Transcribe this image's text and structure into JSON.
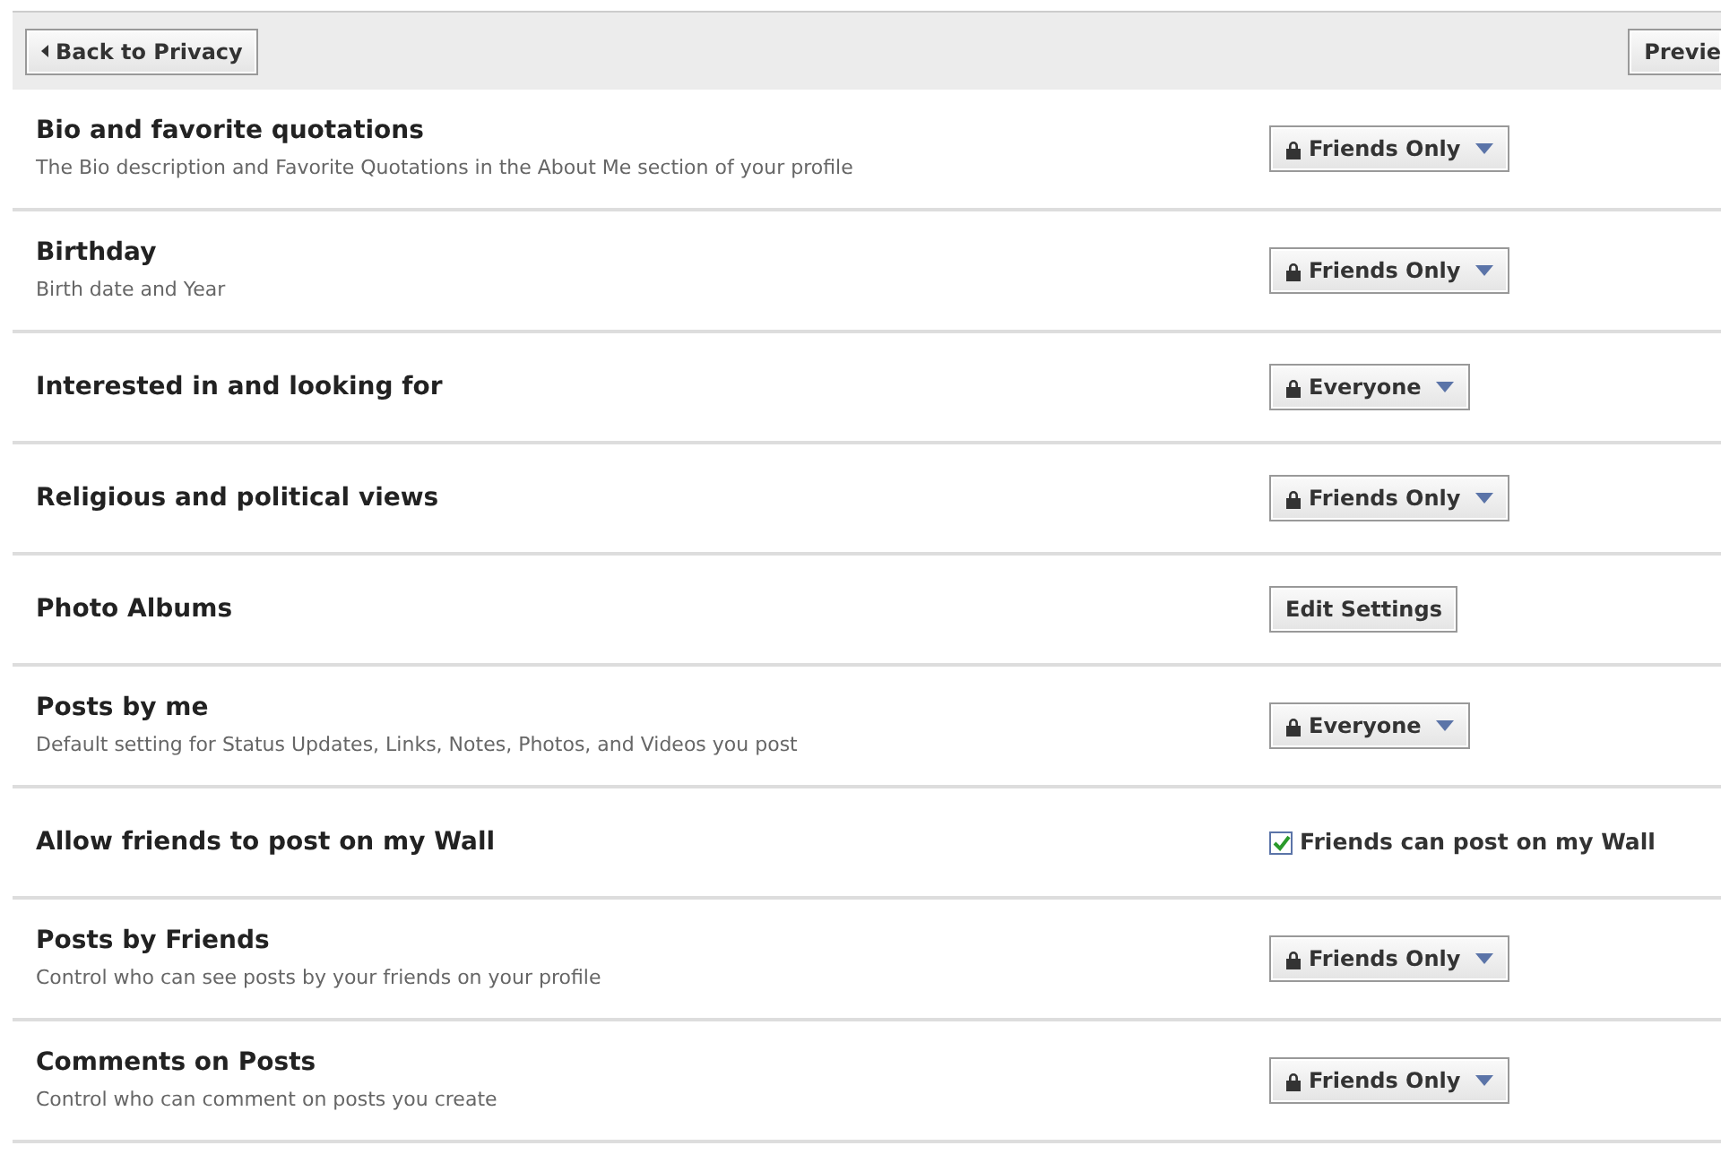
{
  "toolbar": {
    "back_button": "Back to Privacy",
    "preview_button": "Previe"
  },
  "settings": [
    {
      "title": "Bio and favorite quotations",
      "description": "The Bio description and Favorite Quotations in the About Me section of your profile",
      "control": {
        "kind": "dropdown",
        "label": "Friends Only"
      }
    },
    {
      "title": "Birthday",
      "description": "Birth date and Year",
      "control": {
        "kind": "dropdown",
        "label": "Friends Only"
      }
    },
    {
      "title": "Interested in and looking for",
      "control": {
        "kind": "dropdown",
        "label": "Everyone"
      }
    },
    {
      "title": "Religious and political views",
      "control": {
        "kind": "dropdown",
        "label": "Friends Only"
      }
    },
    {
      "title": "Photo Albums",
      "control": {
        "kind": "button",
        "label": "Edit Settings"
      }
    },
    {
      "title": "Posts by me",
      "description": "Default setting for Status Updates, Links, Notes, Photos, and Videos you post",
      "control": {
        "kind": "dropdown",
        "label": "Everyone"
      }
    },
    {
      "title": "Allow friends to post on my Wall",
      "control": {
        "kind": "checkbox",
        "label": "Friends can post on my Wall",
        "checked": true
      }
    },
    {
      "title": "Posts by Friends",
      "description": "Control who can see posts by your friends on your profile",
      "control": {
        "kind": "dropdown",
        "label": "Friends Only"
      }
    },
    {
      "title": "Comments on Posts",
      "description": "Control who can comment on posts you create",
      "control": {
        "kind": "dropdown",
        "label": "Friends Only"
      }
    }
  ]
}
